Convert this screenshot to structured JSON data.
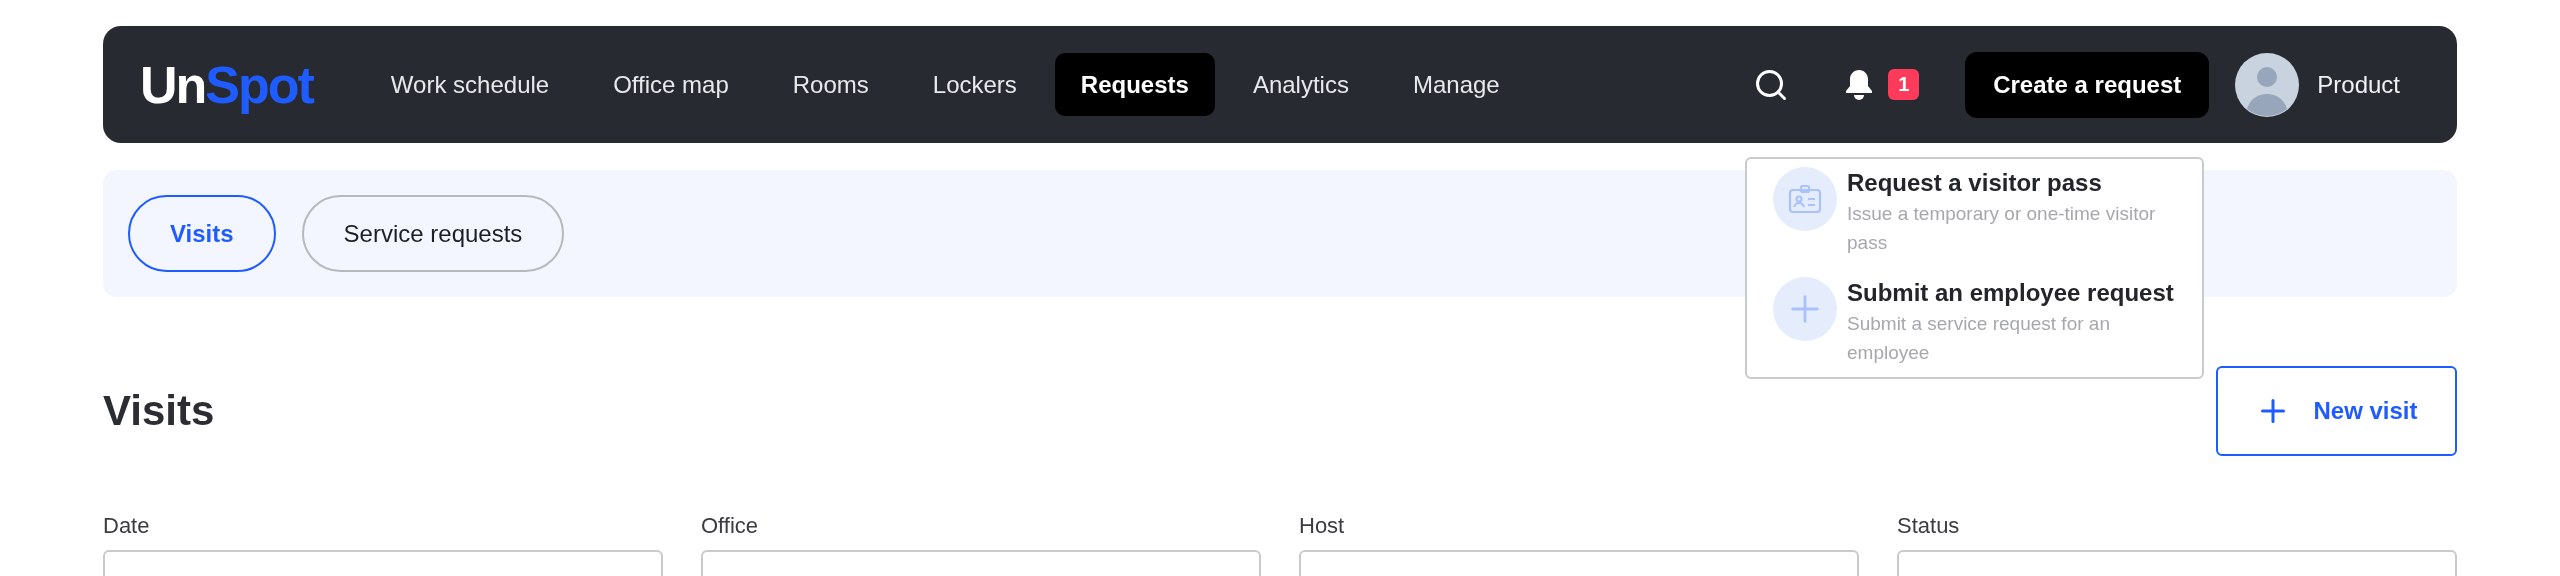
{
  "header": {
    "logo": {
      "part_1": "Un",
      "part_2": "Spot"
    },
    "nav": [
      {
        "label": "Work schedule",
        "selected": false
      },
      {
        "label": "Office map",
        "selected": false
      },
      {
        "label": "Rooms",
        "selected": false
      },
      {
        "label": "Lockers",
        "selected": false
      },
      {
        "label": "Requests",
        "selected": true
      },
      {
        "label": "Analytics",
        "selected": false
      },
      {
        "label": "Manage",
        "selected": false
      }
    ],
    "notifications": {
      "count": "1"
    },
    "create_button": "Create a request",
    "user": {
      "name": "Product"
    }
  },
  "create_menu": {
    "items": [
      {
        "kind": "visitor-pass",
        "title": "Request a visitor pass",
        "description": "Issue a temporary or one-time visitor pass"
      },
      {
        "kind": "employee-request",
        "title": "Submit an employee request",
        "description": "Submit a service request for an employee"
      }
    ]
  },
  "tabs": [
    {
      "label": "Visits",
      "selected": true
    },
    {
      "label": "Service requests",
      "selected": false
    }
  ],
  "section": {
    "title": "Visits",
    "new_button": "New visit"
  },
  "filters": [
    {
      "label": "Date"
    },
    {
      "label": "Office"
    },
    {
      "label": "Host"
    },
    {
      "label": "Status"
    }
  ]
}
